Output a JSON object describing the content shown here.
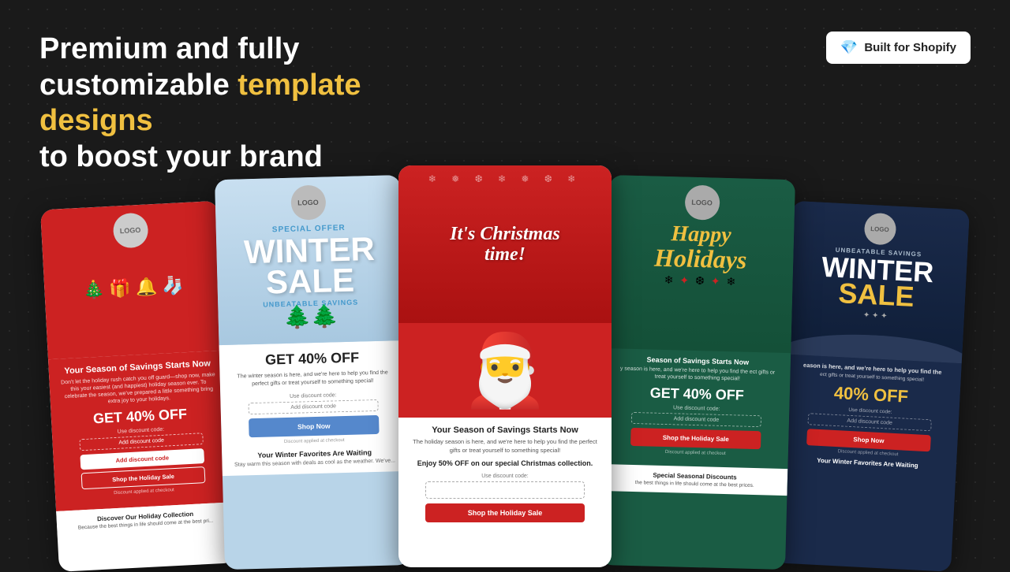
{
  "background": {
    "color": "#1a1a1a"
  },
  "header": {
    "headline_part1": "Premium and fully",
    "headline_part2": "customizable ",
    "headline_highlight": "template designs",
    "headline_part3": " to boost your brand",
    "built_for_shopify": "Built for Shopify",
    "diamond_icon": "💎"
  },
  "cards": {
    "card1": {
      "logo": "LOGO",
      "title": "Your Season of Savings Starts Now",
      "description": "Don't let the holiday rush catch you off guard—shop now, make this your easiest (and happiest) holiday season ever. To celebrate the season, we've prepared a little something bring extra joy to your holidays.",
      "offer": "GET 40% OFF",
      "discount_label": "Use discount code:",
      "input_placeholder": "Add discount code",
      "btn_primary": "Add discount code",
      "btn_secondary": "Shop the Holiday Sale",
      "applied_text": "Discount applied at checkout",
      "footer_title": "Discover Our Holiday Collection",
      "footer_desc": "Because the best things in life should come at the best pri..."
    },
    "card2": {
      "logo": "LOGO",
      "special_offer": "SPECIAL OFFER",
      "winter": "WINTER",
      "sale": "SALE",
      "unbeatable": "UNBEATABLE SAVINGS",
      "offer": "GET 40% OFF",
      "description": "The winter season is here, and we're here to help you find the perfect gifts or treat yourself to something special!",
      "discount_label": "Use discount code:",
      "input_placeholder": "Add discount code",
      "btn": "Shop Now",
      "applied_text": "Discount applied at checkout",
      "footer_title": "Your Winter Favorites Are Waiting",
      "footer_desc": "Stay warm this season with deals as cool as the weather. We've..."
    },
    "card3": {
      "title_line1": "It's Christmas",
      "title_line2": "time!",
      "santa": "🎅",
      "subtitle": "Your Season of Savings Starts Now",
      "description": "The holiday season is here, and we're here to help you find the perfect gifts or treat yourself to something special!",
      "special_offer": "Enjoy 50% OFF on our special Christmas collection.",
      "discount_label": "Use discount code:",
      "input_placeholder": "",
      "btn": "Shop the Holiday Sale"
    },
    "card4": {
      "logo": "LOGO",
      "happy": "Happy",
      "holidays": "Holidays",
      "season_title": "Season of Savings Starts Now",
      "description": "y season is here, and we're here to help you find the ect gifts or treat yourself to something special!",
      "offer": "GET 40% OFF",
      "discount_label": "Use discount code:",
      "input_placeholder": "Add discount code",
      "btn": "Shop the Holiday Sale",
      "applied_text": "Discount applied at checkout",
      "footer_title": "Special Seasonal Discounts",
      "footer_desc": "the best things in life should come at the best prices."
    },
    "card5": {
      "logo": "LOGO",
      "unbeatable": "UNBEATABLE SAVINGS",
      "winter": "WINTER",
      "sale": "SALE",
      "season_title": "eason is here, and we're here to help you find the",
      "description": "ect gifts or treat yourself to something special!",
      "offer": "40% OFF",
      "discount_label": "Use discount code:",
      "input_placeholder": "Add discount code",
      "btn": "Shop Now",
      "applied_text": "Discount applied at checkout",
      "footer_title": "Your Winter Favorites Are Waiting"
    }
  }
}
